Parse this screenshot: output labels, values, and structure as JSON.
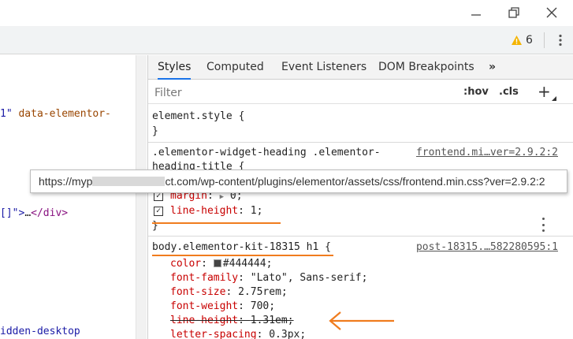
{
  "window": {
    "minimize_icon": "minimize-icon",
    "maximize_icon": "restore-icon",
    "close_icon": "close-icon"
  },
  "toolbar": {
    "warning_count": "6",
    "warning_color": "#f4b400",
    "menu_icon": "kebab-icon"
  },
  "elements_panel": {
    "line1": {
      "val": "1\"",
      "attr": "data-elementor-"
    },
    "line2": {
      "prefix": "[]\">",
      "text": "…",
      "tag": "</div>"
    },
    "line3": "idden-desktop"
  },
  "tabs": [
    {
      "label": "Styles",
      "active": true
    },
    {
      "label": "Computed"
    },
    {
      "label": "Event Listeners"
    },
    {
      "label": "DOM Breakpoints"
    },
    {
      "label": "»"
    }
  ],
  "filter": {
    "placeholder": "Filter",
    "hov": ":hov",
    "cls": ".cls",
    "add": "+"
  },
  "rules": {
    "element_style": {
      "selector": "element.style {",
      "close": "}"
    },
    "heading": {
      "selector_line1": ".elementor-widget-heading .elementor-",
      "selector_line2": "heading-title {",
      "source": "frontend.mi…ver=2.9.2:2",
      "margin_name": "margin",
      "margin_value": "0;",
      "lh_name": "line-height",
      "lh_value": "1;",
      "close": "}"
    },
    "kit": {
      "selector": "body.elementor-kit-18315 h1",
      "brace": "{",
      "source": "post-18315.…582280595:1",
      "props": [
        {
          "name": "color",
          "value": "#444444;",
          "swatch": "#444444"
        },
        {
          "name": "font-family",
          "value": "\"Lato\", Sans-serif;"
        },
        {
          "name": "font-size",
          "value": "2.75rem;"
        },
        {
          "name": "font-weight",
          "value": "700;"
        },
        {
          "name": "line-height",
          "value": "1.31em;",
          "overridden": true
        },
        {
          "name": "letter-spacing",
          "value": "0.3px;"
        }
      ]
    }
  },
  "tooltip": {
    "prefix": "https://myp",
    "suffix": "ct.com/wp-content/plugins/elementor/assets/css/frontend.min.css?ver=2.9.2:2"
  },
  "annotation_color": "#f07c1e"
}
